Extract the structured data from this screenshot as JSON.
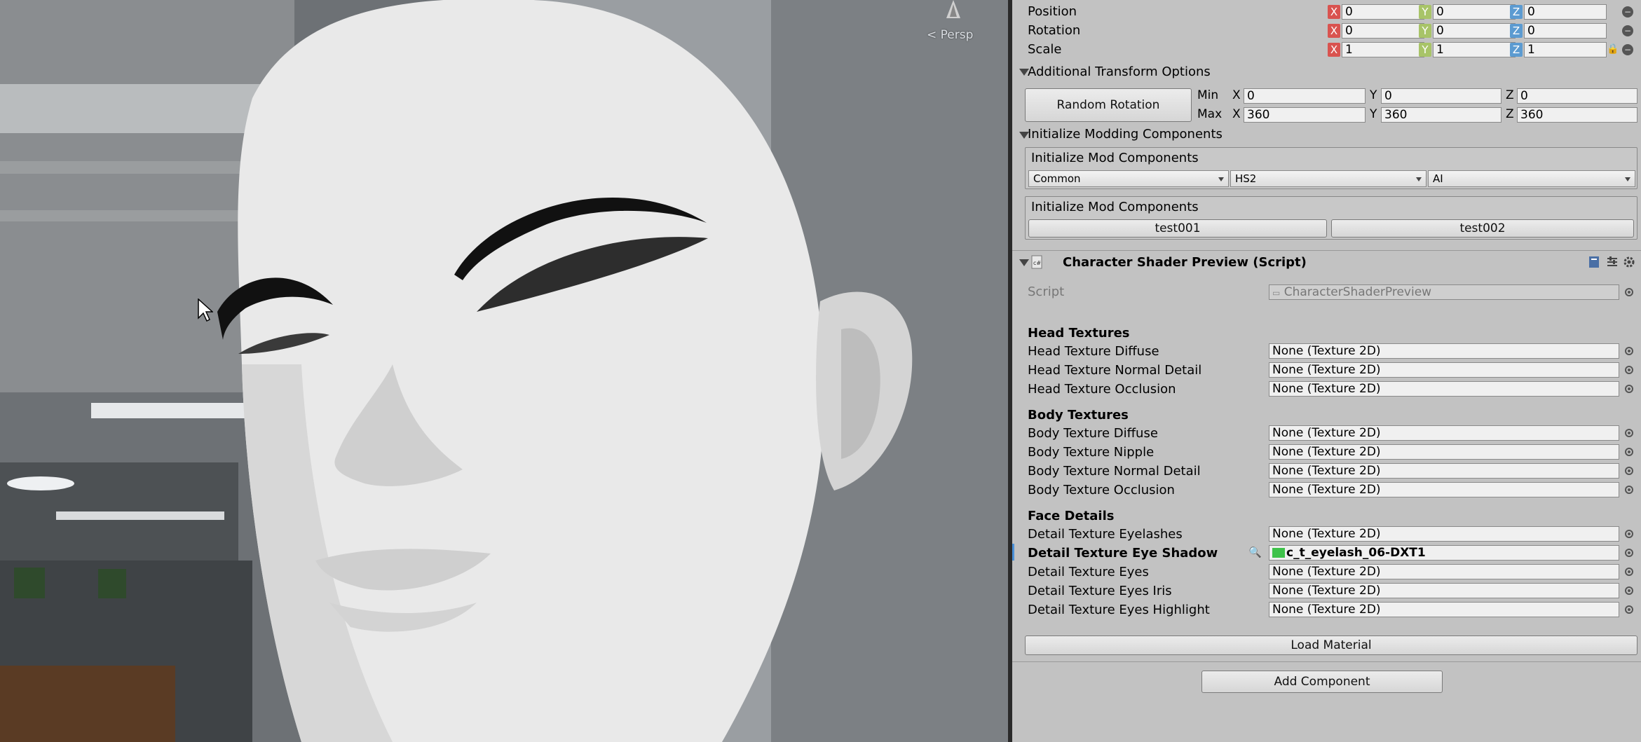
{
  "scene": {
    "camera_label": "< Persp"
  },
  "transform": {
    "position": {
      "label": "Position",
      "x": "0",
      "y": "0",
      "z": "0"
    },
    "rotation": {
      "label": "Rotation",
      "x": "0",
      "y": "0",
      "z": "0"
    },
    "scale": {
      "label": "Scale",
      "x": "1",
      "y": "1",
      "z": "1"
    },
    "axis_x": "X",
    "axis_y": "Y",
    "axis_z": "Z"
  },
  "additional_transform": {
    "header": "Additional Transform Options",
    "random_rotation_label": "Random Rotation",
    "min_label": "Min",
    "max_label": "Max",
    "x_label": "X",
    "y_label": "Y",
    "z_label": "Z",
    "min": {
      "x": "0",
      "y": "0",
      "z": "0"
    },
    "max": {
      "x": "360",
      "y": "360",
      "z": "360"
    }
  },
  "modding": {
    "header": "Initialize Modding Components",
    "box1_title": "Initialize Mod Components",
    "dropdowns": [
      "Common",
      "HS2",
      "AI"
    ],
    "box2_title": "Initialize Mod Components",
    "buttons": [
      "test001",
      "test002"
    ]
  },
  "shader_preview": {
    "title": "Character Shader Preview (Script)",
    "script_label": "Script",
    "script_value": "CharacterShaderPreview",
    "head_header": "Head Textures",
    "head": [
      {
        "label": "Head Texture Diffuse",
        "value": "None (Texture 2D)"
      },
      {
        "label": "Head Texture Normal Detail",
        "value": "None (Texture 2D)"
      },
      {
        "label": "Head Texture Occlusion",
        "value": "None (Texture 2D)"
      }
    ],
    "body_header": "Body Textures",
    "body": [
      {
        "label": "Body Texture Diffuse",
        "value": "None (Texture 2D)"
      },
      {
        "label": "Body Texture Nipple",
        "value": "None (Texture 2D)"
      },
      {
        "label": "Body Texture Normal Detail",
        "value": "None (Texture 2D)"
      },
      {
        "label": "Body Texture Occlusion",
        "value": "None (Texture 2D)"
      }
    ],
    "face_header": "Face Details",
    "face": [
      {
        "label": "Detail Texture Eyelashes",
        "value": "None (Texture 2D)"
      },
      {
        "label": "Detail Texture Eye Shadow",
        "value": "c_t_eyelash_06-DXT1"
      },
      {
        "label": "Detail Texture Eyes",
        "value": "None (Texture 2D)"
      },
      {
        "label": "Detail Texture Eyes Iris",
        "value": "None (Texture 2D)"
      },
      {
        "label": "Detail Texture Eyes Highlight",
        "value": "None (Texture 2D)"
      }
    ],
    "load_material_label": "Load Material"
  },
  "add_component_label": "Add Component"
}
